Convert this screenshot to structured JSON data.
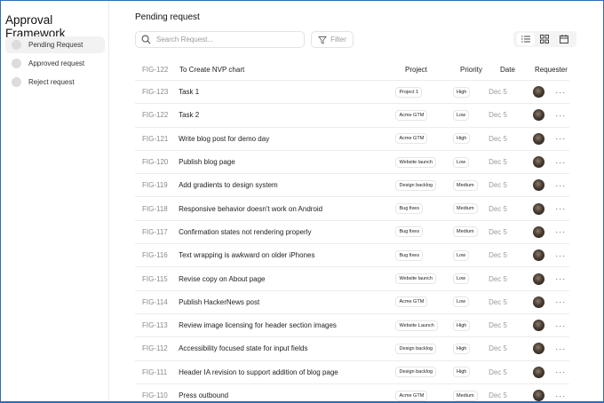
{
  "sidebar": {
    "title": "Approval Framework",
    "items": [
      {
        "label": "Pending Request",
        "active": true
      },
      {
        "label": "Approved request"
      },
      {
        "label": "Reject request"
      }
    ]
  },
  "main": {
    "title": "Pending request",
    "search_placeholder": "Search Request...",
    "filter_label": "Filter",
    "views": [
      "list-icon",
      "grid-icon",
      "calendar-icon"
    ],
    "selected_view": "list-icon"
  },
  "table": {
    "headers": {
      "id": "FIG-122",
      "title": "To Create NVP chart",
      "project": "Project",
      "priority": "Priority",
      "date": "Date",
      "requester": "Requester"
    },
    "rows": [
      {
        "id": "FIG-123",
        "title": "Task 1",
        "project": "Project 1",
        "priority": "High",
        "date": "Dec 5"
      },
      {
        "id": "FIG-122",
        "title": "Task 2",
        "project": "Acme GTM",
        "priority": "Low",
        "date": "Dec 5"
      },
      {
        "id": "FIG-121",
        "title": "Write blog post for demo day",
        "project": "Acme GTM",
        "priority": "High",
        "date": "Dec 5"
      },
      {
        "id": "FIG-120",
        "title": "Publish blog page",
        "project": "Website launch",
        "priority": "Low",
        "date": "Dec 5"
      },
      {
        "id": "FIG-119",
        "title": "Add gradients to design system",
        "project": "Design backlog",
        "priority": "Medium",
        "date": "Dec 5"
      },
      {
        "id": "FIG-118",
        "title": "Responsive behavior doesn't work on Android",
        "project": "Bug fixes",
        "priority": "Medium",
        "date": "Dec 5"
      },
      {
        "id": "FIG-117",
        "title": "Confirmation states not rendering properly",
        "project": "Bug fixes",
        "priority": "Medium",
        "date": "Dec 5"
      },
      {
        "id": "FIG-116",
        "title": "Text wrapping is awkward on older iPhones",
        "project": "Bug fixes",
        "priority": "Low",
        "date": "Dec 5"
      },
      {
        "id": "FIG-115",
        "title": "Revise copy on About page",
        "project": "Website launch",
        "priority": "Low",
        "date": "Dec 5"
      },
      {
        "id": "FIG-114",
        "title": "Publish HackerNews post",
        "project": "Acme GTM",
        "priority": "Low",
        "date": "Dec 5"
      },
      {
        "id": "FIG-113",
        "title": "Review image licensing for header section images",
        "project": "Website Launch",
        "priority": "High",
        "date": "Dec 5"
      },
      {
        "id": "FIG-112",
        "title": "Accessibility focused state for input fields",
        "project": "Design backlog",
        "priority": "High",
        "date": "Dec 5"
      },
      {
        "id": "FIG-111",
        "title": "Header IA revision to support addition of blog page",
        "project": "Design backlog",
        "priority": "High",
        "date": "Dec 5"
      },
      {
        "id": "FIG-110",
        "title": "Press outbound",
        "project": "Acme GTM",
        "priority": "Medium",
        "date": "Dec 5"
      }
    ],
    "more_label": "···"
  }
}
